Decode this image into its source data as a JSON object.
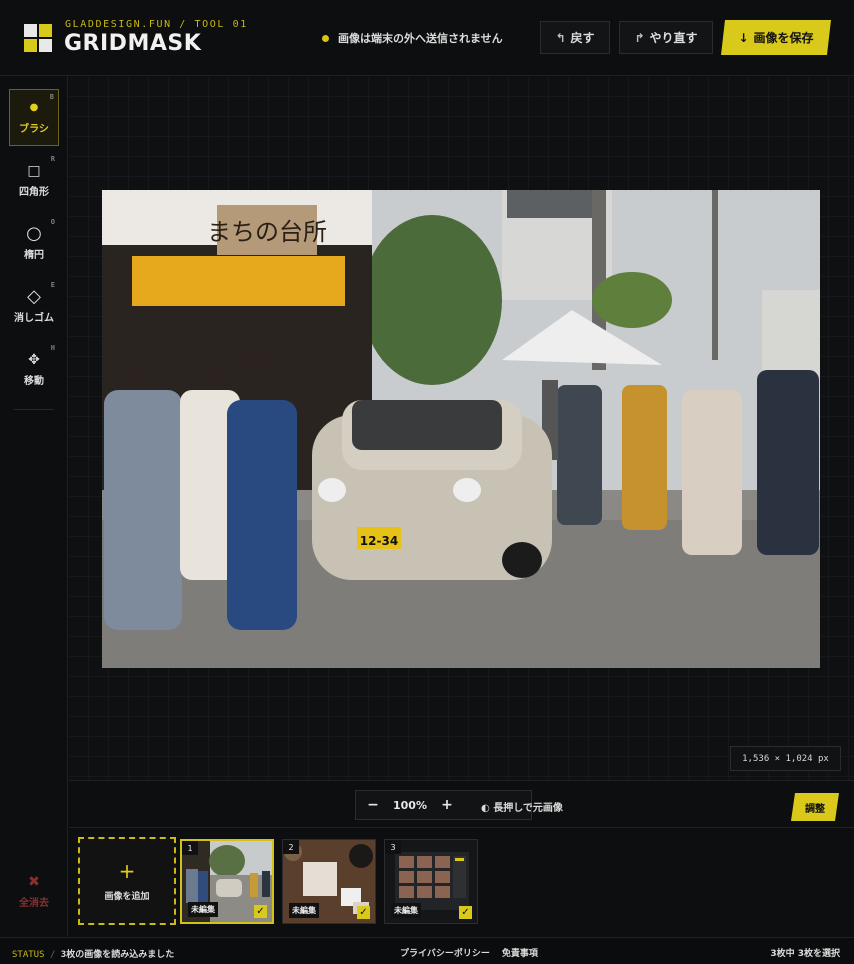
{
  "header": {
    "brand_sub": "GLADDESIGN.FUN / TOOL 01",
    "brand_title": "GRIDMASK",
    "privacy_note": "画像は端末の外へ送信されません",
    "undo_label": "戻す",
    "redo_label": "やり直す",
    "save_label": "画像を保存"
  },
  "tools": [
    {
      "label": "ブラシ",
      "key": "B",
      "icon": "dot-icon"
    },
    {
      "label": "四角形",
      "key": "R",
      "icon": "square-icon"
    },
    {
      "label": "楕円",
      "key": "O",
      "icon": "circle-icon"
    },
    {
      "label": "消しゴム",
      "key": "E",
      "icon": "diamond-icon"
    },
    {
      "label": "移動",
      "key": "H",
      "icon": "move-arrows-icon"
    }
  ],
  "clear_all_label": "全消去",
  "canvas": {
    "dimensions": "1,536 × 1,024 px",
    "sign_text": "まちの台所",
    "plate_text": "12-34"
  },
  "zoom": {
    "minus": "−",
    "value": "100%",
    "plus": "+",
    "hold_hint": "長押しで元画像",
    "adjust_label": "調整"
  },
  "thumbnails": {
    "add_label": "画像を追加",
    "items": [
      {
        "num": "1",
        "status": "未編集",
        "selected": true
      },
      {
        "num": "2",
        "status": "未編集",
        "selected": false
      },
      {
        "num": "3",
        "status": "未編集",
        "selected": false
      }
    ]
  },
  "status": {
    "label": "STATUS",
    "message": "3枚の画像を読み込みました",
    "privacy_link": "プライバシーポリシー",
    "disclaimer_link": "免責事項",
    "selection": "3枚中 3枚を選択"
  },
  "colors": {
    "accent": "#d9c91a",
    "background": "#0d0e0f",
    "danger": "#8a2f2f"
  }
}
